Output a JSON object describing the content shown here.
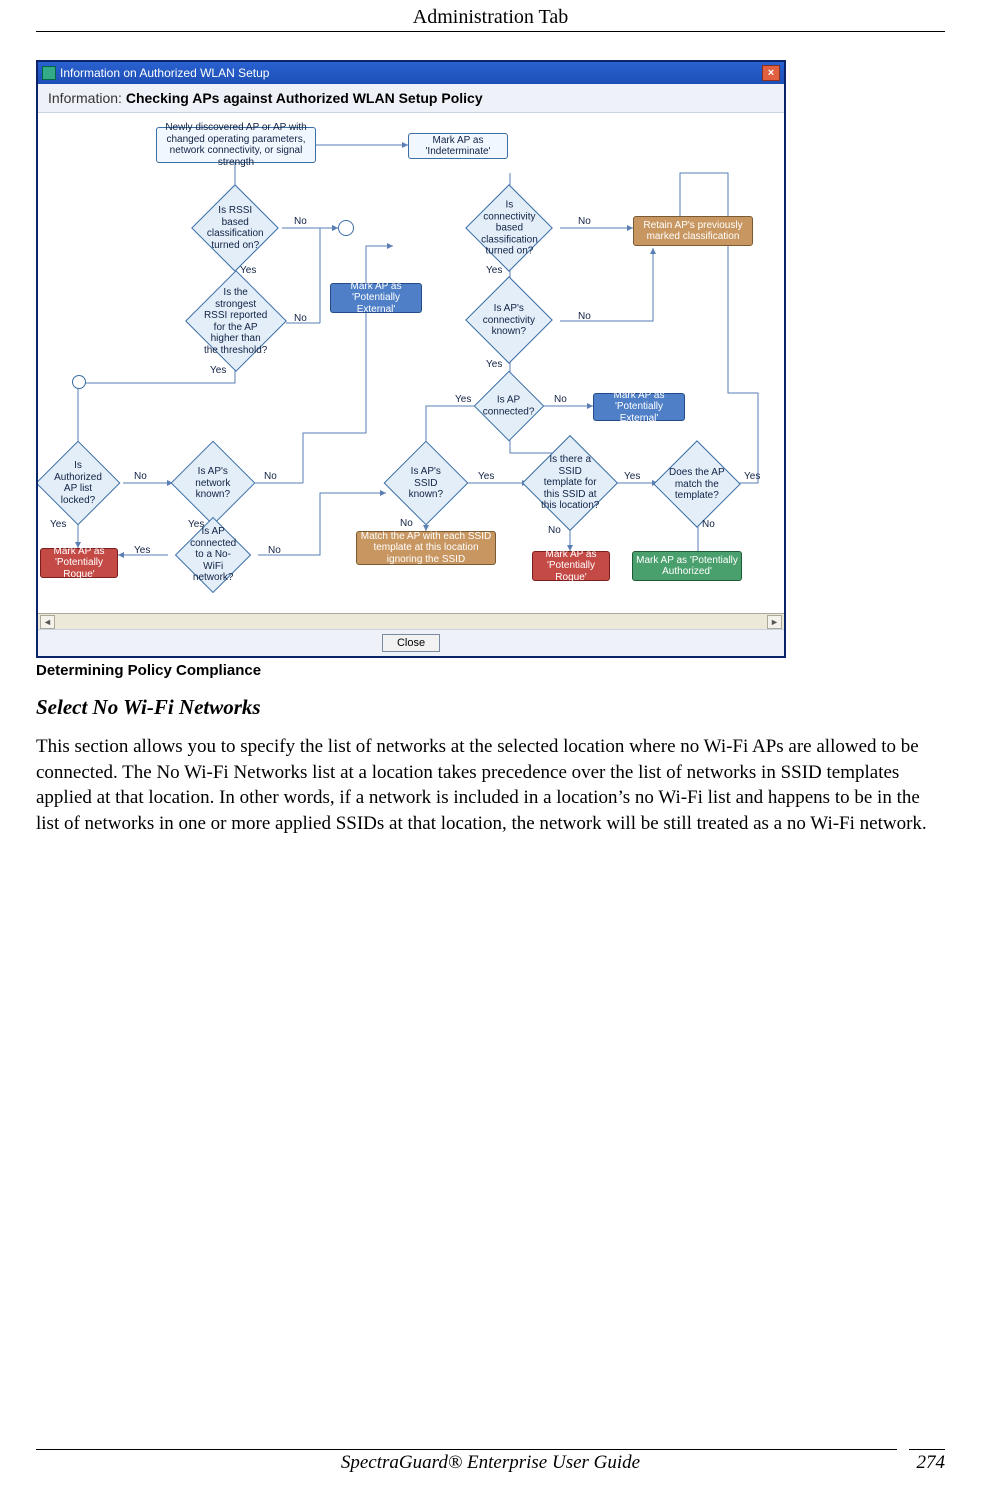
{
  "header": {
    "running_head": "Administration Tab"
  },
  "figure": {
    "dialog_title": "Information on Authorized WLAN Setup",
    "info_label": "Information:",
    "info_bold": "Checking APs against Authorized WLAN Setup Policy",
    "close_button_label": "Close",
    "caption": "Determining Policy Compliance",
    "nodes": {
      "n_new": "Newly discovered AP or AP with changed operating parameters, network connectivity, or signal strength",
      "n_mark_ind": "Mark AP as 'Indeterminate'",
      "d_rssi_on": "Is RSSI based classification turned on?",
      "d_conn_on": "Is connectivity based classification turned on?",
      "b_pot_ext1": "Mark AP as 'Potentially External'",
      "r_retain": "Retain AP's previously marked classification",
      "d_rssi_thr": "Is the strongest RSSI reported for the AP higher than the threshold?",
      "d_conn_known": "Is AP's connectivity known?",
      "d_ap_connected": "Is AP connected?",
      "b_pot_ext2": "Mark AP as 'Potentially External'",
      "d_auth_locked": "Is Authorized AP list locked?",
      "d_net_known": "Is AP's network known?",
      "d_ssid_known": "Is AP's SSID known?",
      "d_tmpl_exists": "Is there a SSID template for this SSID at this location?",
      "d_match_tmpl": "Does the AP match the template?",
      "r_mark_rogue1": "Mark AP as 'Potentially Rogue'",
      "d_nowifi": "Is AP connected to a No-WiFi network?",
      "o_match_ssid": "Match the AP with each SSID template at this location ignoring the SSID",
      "r_mark_rogue2": "Mark AP as 'Potentially Rogue'",
      "g_mark_auth": "Mark AP as 'Potentially Authorized'"
    },
    "labels": {
      "yes": "Yes",
      "no": "No"
    }
  },
  "section": {
    "heading": "Select No Wi-Fi Networks",
    "body": "This section allows you to specify the list of networks at the selected location where no Wi-Fi APs are allowed to be connected. The No Wi-Fi Networks list at a location takes precedence over the list of networks in SSID templates applied at that location. In other words, if a network is included in a location’s no Wi-Fi list and happens to be in the list of networks in one or more applied SSIDs at that location, the network will be still treated as a no Wi-Fi network."
  },
  "footer": {
    "center": "SpectraGuard® Enterprise User Guide",
    "page_number": "274"
  }
}
